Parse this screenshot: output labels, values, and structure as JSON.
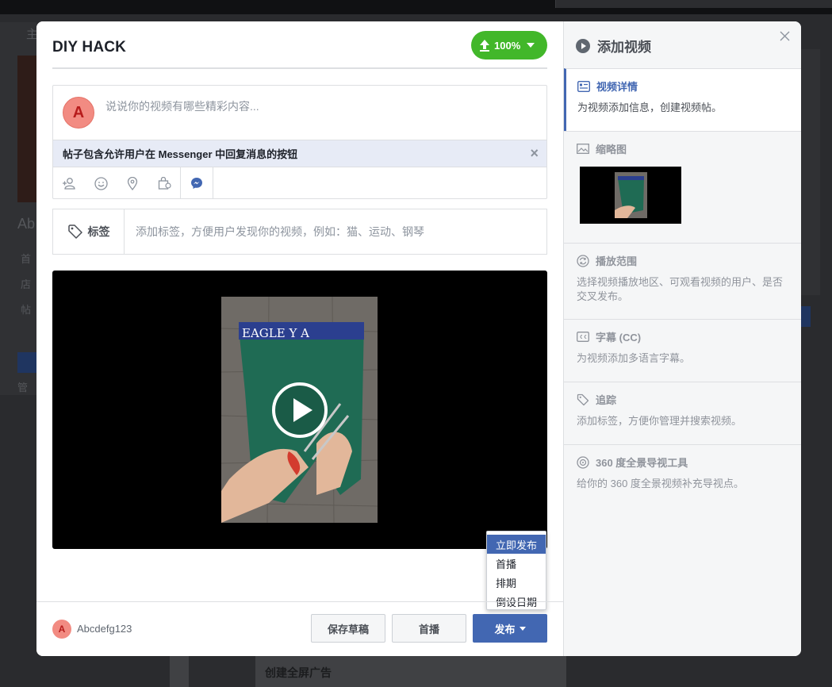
{
  "modal": {
    "title": "DIY HACK",
    "upload_progress": "100%",
    "composer": {
      "avatar_letter": "A",
      "placeholder": "说说你的视频有哪些精彩内容...",
      "messenger_notice": "帖子包含允许用户在 Messenger 中回复消息的按钮",
      "tools": [
        "tag-people-icon",
        "emoji-icon",
        "location-pin-icon",
        "shopping-bag-icon",
        "messenger-icon"
      ]
    },
    "tags": {
      "label": "标签",
      "placeholder": "添加标签，方便用户发现你的视频，例如：猫、运动、钢琴"
    },
    "video": {
      "overlay_text": "EAGLE Y A"
    },
    "footer": {
      "user_letter": "A",
      "user_name": "Abcdefg123",
      "save_draft": "保存草稿",
      "premiere": "首播",
      "publish": "发布"
    },
    "publish_menu": {
      "items": [
        "立即发布",
        "首播",
        "排期",
        "倒设日期"
      ],
      "selected": "立即发布"
    }
  },
  "side_panel": {
    "title": "添加视频",
    "sections": [
      {
        "title": "视频详情",
        "desc": "为视频添加信息，创建视频帖。",
        "icon": "video-details-icon",
        "active": true
      },
      {
        "title": "缩略图",
        "desc": "",
        "icon": "thumbnail-icon",
        "active": false
      },
      {
        "title": "播放范围",
        "desc": "选择视频播放地区、可观看视频的用户、是否交叉发布。",
        "icon": "distribution-icon",
        "active": false
      },
      {
        "title": "字幕 (CC)",
        "desc": "为视频添加多语言字幕。",
        "icon": "captions-icon",
        "active": false
      },
      {
        "title": "追踪",
        "desc": "添加标签，方便你管理并搜索视频。",
        "icon": "tag-icon",
        "active": false
      },
      {
        "title": "360 度全景导视工具",
        "desc": "给你的 360 度全景视频补充导视点。",
        "icon": "360-guide-icon",
        "active": false
      }
    ]
  },
  "background": {
    "bottom_card_text": "创建全屏广告",
    "left_fragments": [
      "主",
      "Ab",
      "首",
      "店",
      "帖",
      "管"
    ]
  },
  "colors": {
    "accent_blue": "#4267b2",
    "upload_green": "#42b72a",
    "notice_bg": "#e7ebf6",
    "avatar_red": "#f28b82"
  }
}
